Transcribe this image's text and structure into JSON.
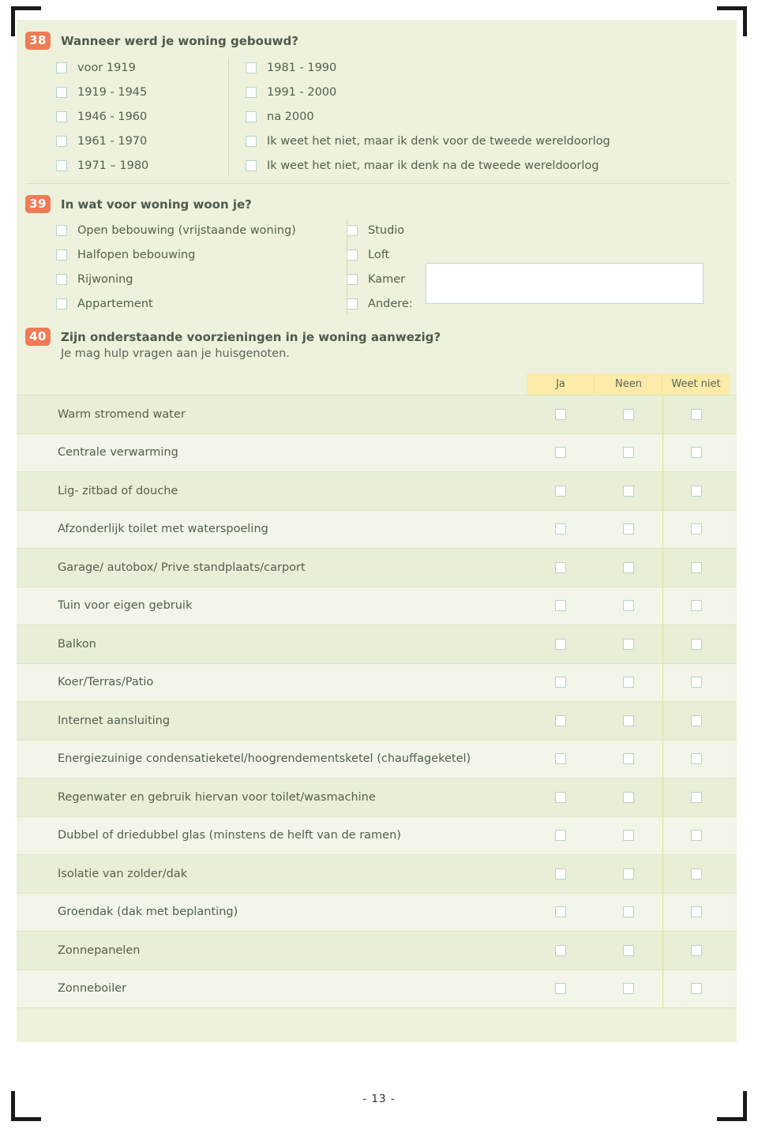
{
  "page": {
    "footer_label": "- 13 -"
  },
  "questions": [
    {
      "number": "38",
      "title": "Wanneer werd je woning gebouwd?",
      "options_left": [
        "voor 1919",
        "1919 - 1945",
        "1946 - 1960",
        "1961 - 1970",
        "1971 – 1980"
      ],
      "options_right": [
        "1981 - 1990",
        "1991 - 2000",
        "na 2000",
        "Ik weet het niet, maar ik denk voor de tweede wereldoorlog",
        "Ik weet het niet, maar ik denk na de tweede wereldoorlog"
      ]
    },
    {
      "number": "39",
      "title": "In wat voor woning woon je?",
      "options_left": [
        "Open bebouwing (vrijstaande woning)",
        "Halfopen bebouwing",
        "Rijwoning",
        "Appartement"
      ],
      "options_right": [
        "Studio",
        "Loft",
        "Kamer",
        "Andere:"
      ],
      "other_input_value": "",
      "other_input_placeholder": ""
    },
    {
      "number": "40",
      "title": "Zijn onderstaande voorzieningen in je woning aanwezig?",
      "subtitle": "Je mag hulp vragen aan je huisgenoten.",
      "columns": [
        "Ja",
        "Neen",
        "Weet niet"
      ],
      "rows": [
        "Warm stromend water",
        "Centrale verwarming",
        "Lig- zitbad of douche",
        "Afzonderlijk toilet met waterspoeling",
        "Garage/ autobox/ Prive standplaats/carport",
        "Tuin voor eigen gebruik",
        "Balkon",
        "Koer/Terras/Patio",
        "Internet aansluiting",
        "Energiezuinige condensatieketel/hoogrendementsketel (chauffageketel)",
        "Regenwater en gebruik hiervan voor toilet/wasmachine",
        "Dubbel of driedubbel glas (minstens de helft van de ramen)",
        "Isolatie van zolder/dak",
        "Groendak (dak met beplanting)",
        "Zonnepanelen",
        "Zonneboiler"
      ]
    }
  ],
  "colors": {
    "page_background": "#eef1dc",
    "number_badge": "#ef7b56",
    "header_row": "#fbeaa8",
    "checkbox_border": "#b4d4cb",
    "row_odd": "#e9eed7",
    "row_even": "#f2f5e7",
    "text": "#53604f"
  }
}
